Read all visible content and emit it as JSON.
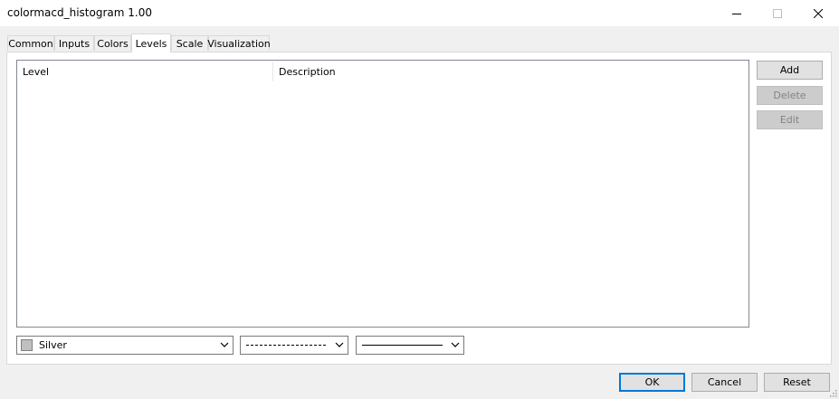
{
  "window": {
    "title": "colormacd_histogram 1.00"
  },
  "tabs": [
    {
      "label": "Common"
    },
    {
      "label": "Inputs"
    },
    {
      "label": "Colors"
    },
    {
      "label": "Levels"
    },
    {
      "label": "Scale"
    },
    {
      "label": "Visualization"
    }
  ],
  "active_tab": "Levels",
  "levels_table": {
    "columns": [
      "Level",
      "Description"
    ],
    "rows": []
  },
  "side_buttons": {
    "add": "Add",
    "delete": "Delete",
    "edit": "Edit"
  },
  "style_controls": {
    "color_value": "Silver",
    "color_hex": "#c0c0c0",
    "line_style": "dashed",
    "line_width": "solid"
  },
  "footer_buttons": {
    "ok": "OK",
    "cancel": "Cancel",
    "reset": "Reset"
  }
}
